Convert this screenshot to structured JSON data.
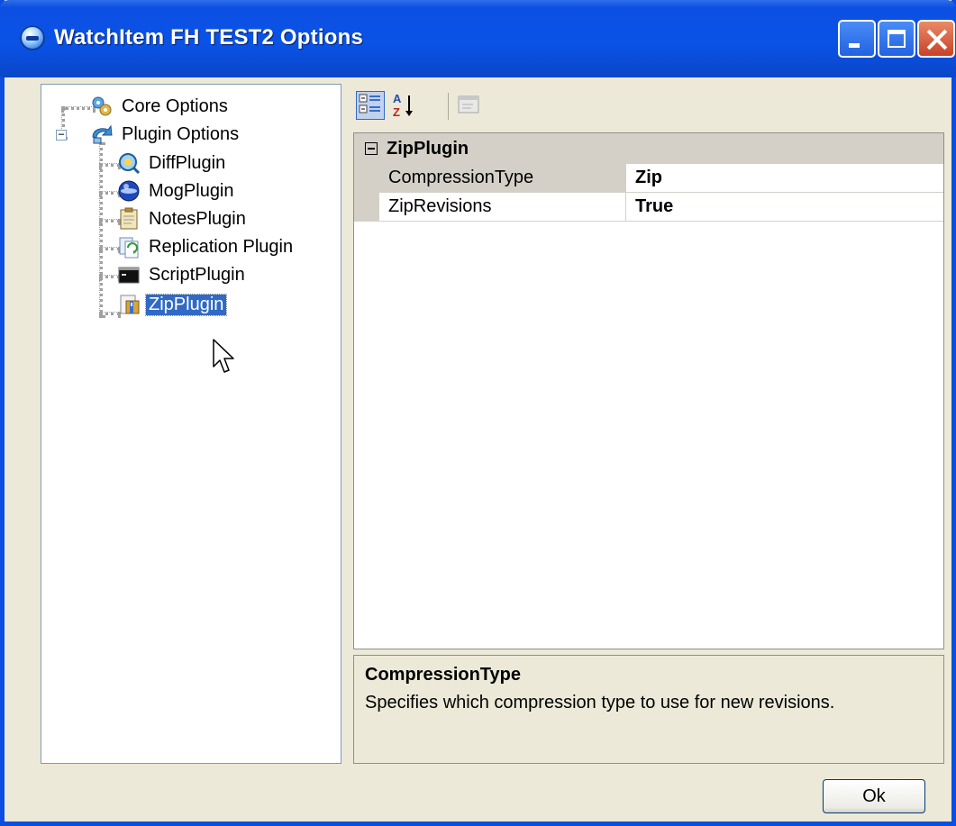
{
  "window": {
    "title": "WatchItem FH TEST2 Options"
  },
  "tree": {
    "nodes": [
      {
        "label": "Core Options",
        "icon": "gears-icon"
      },
      {
        "label": "Plugin Options",
        "icon": "plugin-icon"
      },
      {
        "label": "DiffPlugin",
        "icon": "magnifier-icon"
      },
      {
        "label": "MogPlugin",
        "icon": "blue-globe-icon"
      },
      {
        "label": "NotesPlugin",
        "icon": "clipboard-icon"
      },
      {
        "label": "Replication Plugin",
        "icon": "replication-icon"
      },
      {
        "label": "ScriptPlugin",
        "icon": "console-icon"
      },
      {
        "label": "ZipPlugin",
        "icon": "zip-icon"
      }
    ],
    "selected": "ZipPlugin"
  },
  "grid": {
    "category": "ZipPlugin",
    "properties": [
      {
        "name": "CompressionType",
        "value": "Zip"
      },
      {
        "name": "ZipRevisions",
        "value": "True"
      }
    ]
  },
  "description": {
    "title": "CompressionType",
    "text": "Specifies which compression type to use for new revisions."
  },
  "buttons": {
    "ok": "Ok"
  },
  "colors": {
    "titlebar": "#0953e7",
    "selection": "#316ac5",
    "window_bg": "#ece9d8"
  }
}
